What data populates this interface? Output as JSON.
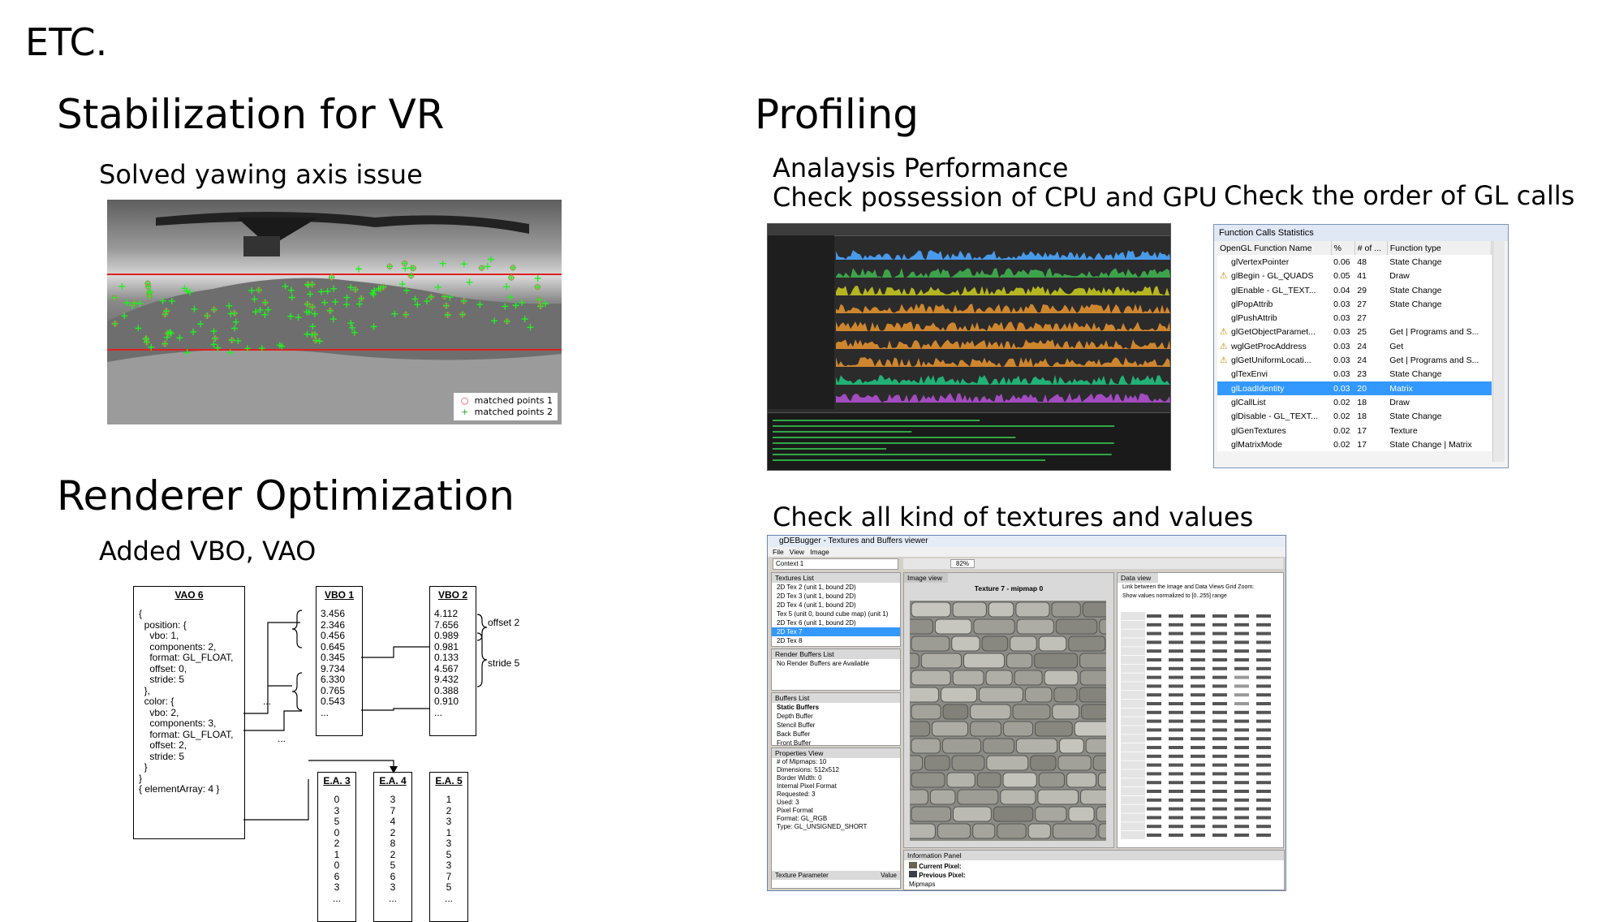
{
  "page_title": "ETC.",
  "stabilization": {
    "heading": "Stabilization for VR",
    "subheading": "Solved yawing axis issue",
    "legend": [
      {
        "marker": "○",
        "label": "matched points 1",
        "color": "#e04040"
      },
      {
        "marker": "+",
        "label": "matched points 2",
        "color": "#20b020"
      }
    ]
  },
  "renderer": {
    "heading": "Renderer Optimization",
    "subheading": "Added VBO, VAO",
    "vao": {
      "title": "VAO 6",
      "lines": [
        "{",
        "  position: {",
        "    vbo: 1,",
        "    components: 2,",
        "    format: GL_FLOAT,",
        "    offset: 0,",
        "    stride: 5",
        "  },",
        "  color: {",
        "    vbo: 2,",
        "    components: 3,",
        "    format: GL_FLOAT,",
        "    offset: 2,",
        "    stride: 5",
        "  }",
        "}",
        "",
        "{ elementArray: 4 }"
      ]
    },
    "vbo1": {
      "title": "VBO 1",
      "values": [
        "3.456",
        "2.346",
        "0.456",
        "0.645",
        "0.345",
        "9.734",
        "6.330",
        "0.765",
        "0.543",
        "..."
      ]
    },
    "vbo2": {
      "title": "VBO 2",
      "values": [
        "4.112",
        "7.656",
        "0.989",
        "0.981",
        "0.133",
        "4.567",
        "9.432",
        "0.388",
        "0.910",
        "..."
      ]
    },
    "offset_label": "offset 2",
    "stride_label": "stride 5",
    "ellipsis": "...",
    "ea3": {
      "title": "E.A. 3",
      "values": [
        "0",
        "3",
        "5",
        "0",
        "2",
        "1",
        "0",
        "6",
        "3",
        "..."
      ]
    },
    "ea4": {
      "title": "E.A. 4",
      "values": [
        "3",
        "7",
        "4",
        "2",
        "8",
        "2",
        "5",
        "6",
        "3",
        "..."
      ]
    },
    "ea5": {
      "title": "E.A. 5",
      "values": [
        "1",
        "2",
        "3",
        "1",
        "3",
        "5",
        "3",
        "7",
        "5",
        "..."
      ]
    }
  },
  "profiling": {
    "heading": "Profiling",
    "perf_line1": "Analaysis Performance",
    "perf_line2": "Check possession of CPU and GPU",
    "gl_order": "Check the order of GL calls",
    "textures": "Check all kind of textures and values",
    "gl_window": {
      "title": "Function Calls Statistics",
      "headers": [
        "OpenGL Function Name",
        "%",
        "# of ...",
        "Function type"
      ],
      "rows": [
        {
          "warn": "",
          "name": "glVertexPointer",
          "pct": "0.06",
          "count": "48",
          "type": "State Change"
        },
        {
          "warn": "⚠",
          "name": "glBegin - GL_QUADS",
          "pct": "0.05",
          "count": "41",
          "type": "Draw"
        },
        {
          "warn": "",
          "name": "glEnable - GL_TEXT...",
          "pct": "0.04",
          "count": "29",
          "type": "State Change"
        },
        {
          "warn": "",
          "name": "glPopAttrib",
          "pct": "0.03",
          "count": "27",
          "type": "State Change"
        },
        {
          "warn": "",
          "name": "glPushAttrib",
          "pct": "0.03",
          "count": "27",
          "type": ""
        },
        {
          "warn": "⚠",
          "name": "glGetObjectParamet...",
          "pct": "0.03",
          "count": "25",
          "type": "Get | Programs and S..."
        },
        {
          "warn": "⚠",
          "name": "wglGetProcAddress",
          "pct": "0.03",
          "count": "24",
          "type": "Get"
        },
        {
          "warn": "⚠",
          "name": "glGetUniformLocati...",
          "pct": "0.03",
          "count": "24",
          "type": "Get | Programs and S..."
        },
        {
          "warn": "",
          "name": "glTexEnvi",
          "pct": "0.03",
          "count": "23",
          "type": "State Change"
        },
        {
          "warn": "",
          "name": "glLoadIdentity",
          "pct": "0.03",
          "count": "20",
          "type": "Matrix",
          "selected": true
        },
        {
          "warn": "",
          "name": "glCallList",
          "pct": "0.02",
          "count": "18",
          "type": "Draw"
        },
        {
          "warn": "",
          "name": "glDisable - GL_TEXT...",
          "pct": "0.02",
          "count": "18",
          "type": "State Change"
        },
        {
          "warn": "",
          "name": "glGenTextures",
          "pct": "0.02",
          "count": "17",
          "type": "Texture"
        },
        {
          "warn": "",
          "name": "glMatrixMode",
          "pct": "0.02",
          "count": "17",
          "type": "State Change | Matrix"
        }
      ]
    },
    "tex_window": {
      "title": "gDEBugger - Textures and Buffers viewer",
      "menu": [
        "File",
        "View",
        "Image"
      ],
      "context": "Context 1",
      "zoom": "82%",
      "textures_list_title": "Textures List",
      "textures": [
        "2D Tex 2 (unit 1, bound 2D)",
        "2D Tex 3 (unit 1, bound 2D)",
        "2D Tex 4 (unit 1, bound 2D)",
        "Tex 5 (unit 0, bound cube map) (unit 1)",
        "2D Tex 6 (unit 1, bound 2D)",
        "2D Tex 7",
        "2D Tex 8"
      ],
      "render_buffers_title": "Render Buffers List",
      "render_buffers": [
        "No Render Buffers are Available"
      ],
      "buffers_title": "Buffers List",
      "buffers": [
        "Static Buffers",
        "Depth Buffer",
        "Stencil Buffer",
        "Back Buffer",
        "Front Buffer"
      ],
      "properties_title": "Properties View",
      "properties": [
        "# of Mipmaps: 10",
        "Dimensions: 512x512",
        "Border Width: 0",
        "",
        "Internal Pixel Format",
        "Requested: 3",
        "Used: 3",
        "",
        "Pixel Format",
        "Format: GL_RGB",
        "Type: GL_UNSIGNED_SHORT"
      ],
      "image_tab": "Image view",
      "image_title": "Texture 7 - mipmap 0",
      "data_tab": "Data view",
      "link_checkbox": "Link between the Image and Data Views  Grid Zoom:",
      "normalize_checkbox": "Show values normalized to [0..255] range",
      "info_title": "Information Panel",
      "current_pixel": "Current Pixel:",
      "previous_pixel": "Previous Pixel:",
      "mipmaps_label": "Mipmaps",
      "tex_param": "Texture Parameter",
      "tex_value": "Value"
    }
  }
}
